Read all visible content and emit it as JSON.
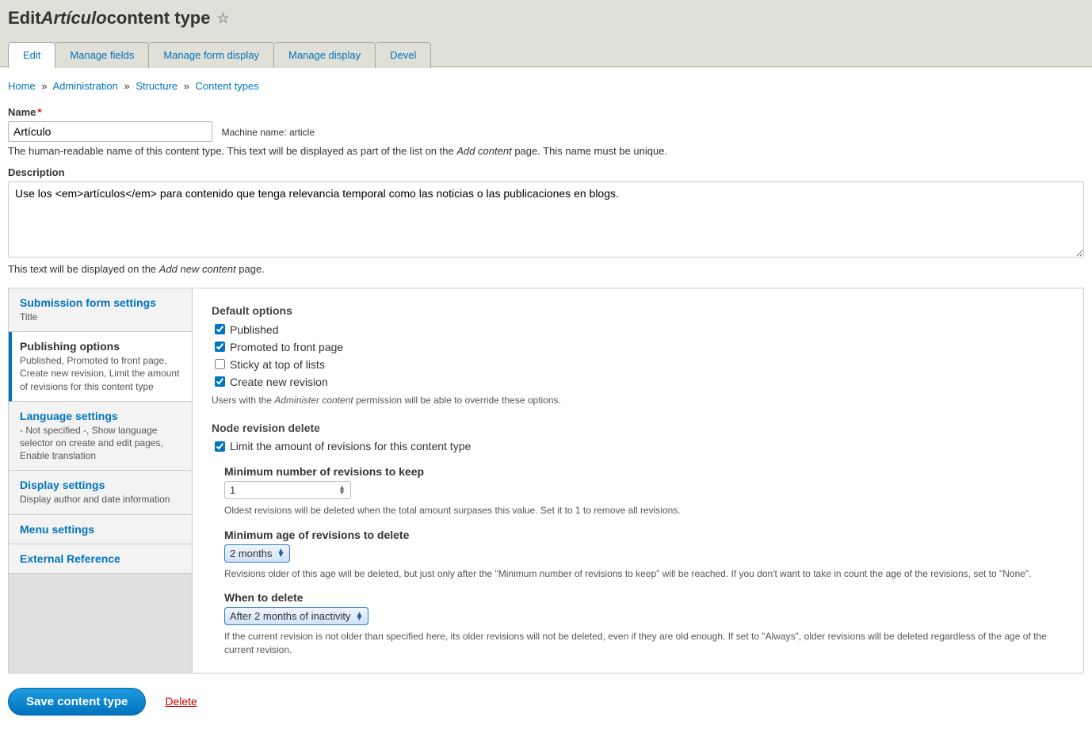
{
  "page_title_prefix": "Edit ",
  "page_title_name": "Artículo",
  "page_title_suffix": " content type",
  "tabs": [
    {
      "label": "Edit",
      "active": true
    },
    {
      "label": "Manage fields"
    },
    {
      "label": "Manage form display"
    },
    {
      "label": "Manage display"
    },
    {
      "label": "Devel"
    }
  ],
  "breadcrumb": [
    {
      "label": "Home"
    },
    {
      "label": "Administration"
    },
    {
      "label": "Structure"
    },
    {
      "label": "Content types"
    }
  ],
  "name_field": {
    "label": "Name",
    "value": "Artículo",
    "machine_name_label": "Machine name: article",
    "help_p1": "The human-readable name of this content type. This text will be displayed as part of the list on the ",
    "help_em": "Add content",
    "help_p2": " page. This name must be unique."
  },
  "description_field": {
    "label": "Description",
    "value": "Use los <em>artículos</em> para contenido que tenga relevancia temporal como las noticias o las publicaciones en blogs.",
    "help_p1": "This text will be displayed on the ",
    "help_em": "Add new content",
    "help_p2": " page."
  },
  "vtabs": [
    {
      "title": "Submission form settings",
      "summary": "Title"
    },
    {
      "title": "Publishing options",
      "summary": "Published, Promoted to front page, Create new revision, Limit the amount of revisions for this content type",
      "active": true
    },
    {
      "title": "Language settings",
      "summary": "- Not specified -, Show language selector on create and edit pages, Enable translation"
    },
    {
      "title": "Display settings",
      "summary": "Display author and date information"
    },
    {
      "title": "Menu settings",
      "summary": ""
    },
    {
      "title": "External Reference",
      "summary": ""
    }
  ],
  "panel": {
    "default_options_label": "Default options",
    "options": {
      "published": {
        "label": "Published",
        "checked": true
      },
      "promoted": {
        "label": "Promoted to front page",
        "checked": true
      },
      "sticky": {
        "label": "Sticky at top of lists",
        "checked": false
      },
      "revision": {
        "label": "Create new revision",
        "checked": true
      }
    },
    "options_help_p1": "Users with the ",
    "options_help_em": "Administer content",
    "options_help_p2": " permission will be able to override these options.",
    "nrd_label": "Node revision delete",
    "limit": {
      "label": "Limit the amount of revisions for this content type",
      "checked": true
    },
    "min_keep": {
      "label": "Minimum number of revisions to keep",
      "value": "1",
      "help": "Oldest revisions will be deleted when the total amount surpases this value. Set it to 1 to remove all revisions."
    },
    "min_age": {
      "label": "Minimum age of revisions to delete",
      "value": "2 months",
      "help": "Revisions older of this age will be deleted, but just only after the \"Minimum number of revisions to keep\" will be reached. If you don't want to take in count the age of the revisions, set to \"None\"."
    },
    "when": {
      "label": "When to delete",
      "value": "After 2 months of inactivity",
      "help": "If the current revision is not older than specified here, its older revisions will not be deleted, even if they are old enough. If set to \"Always\", older revisions will be deleted regardless of the age of the current revision."
    }
  },
  "actions": {
    "save": "Save content type",
    "delete": "Delete"
  }
}
